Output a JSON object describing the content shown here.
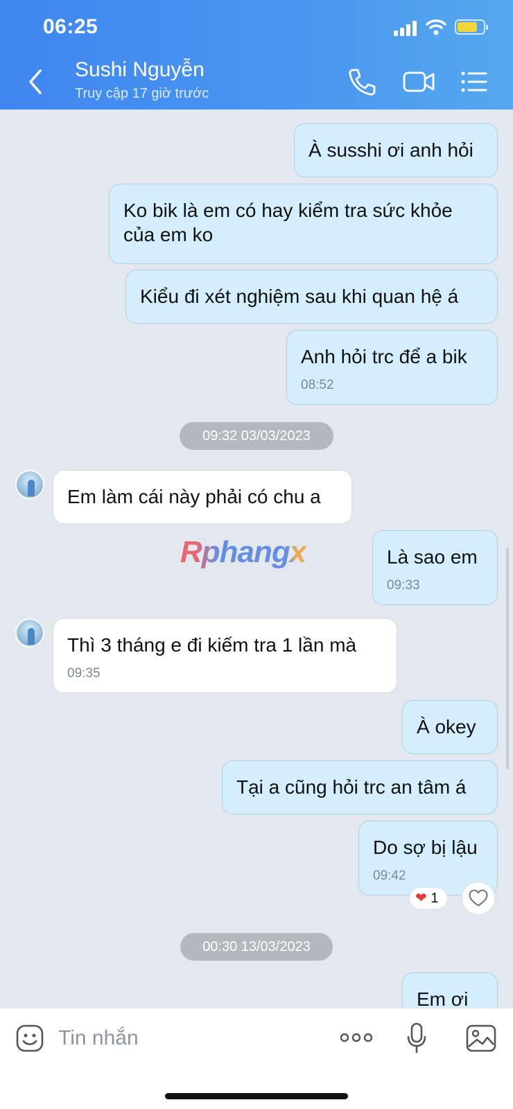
{
  "status_bar": {
    "time": "06:25"
  },
  "header": {
    "contact_name": "Sushi Nguyễn",
    "contact_status": "Truy cập 17 giờ trước"
  },
  "messages": [
    {
      "sender": "me",
      "text": "À susshi ơi anh hỏi"
    },
    {
      "sender": "me",
      "text": "Ko bik là em có hay kiểm tra sức khỏe của em ko"
    },
    {
      "sender": "me",
      "text": "Kiểu đi xét nghiệm sau khi quan hệ á"
    },
    {
      "sender": "me",
      "text": "Anh hỏi trc để a bik",
      "time": "08:52"
    },
    {
      "sender": "them",
      "text": "Em làm cái này phải có chu a"
    },
    {
      "sender": "me",
      "text": "Là sao em",
      "time": "09:33"
    },
    {
      "sender": "them",
      "text": "Thì 3 tháng e đi kiếm tra 1 lần mà",
      "time": "09:35"
    },
    {
      "sender": "me",
      "text": "À okey"
    },
    {
      "sender": "me",
      "text": "Tại a cũng hỏi trc an tâm á"
    },
    {
      "sender": "me",
      "text": "Do sợ bị lậu",
      "time": "09:42",
      "reaction": {
        "emoji": "❤️",
        "count": "1"
      }
    },
    {
      "sender": "me",
      "text": "Em ơi"
    }
  ],
  "date_separators": [
    "09:32 03/03/2023",
    "00:30 13/03/2023"
  ],
  "watermark": "Rphangx",
  "reaction_heart": "❤",
  "input": {
    "placeholder": "Tin nhắn"
  },
  "icons": {
    "back": "chevron-left-icon",
    "call": "phone-icon",
    "video": "video-camera-icon",
    "menu": "list-menu-icon",
    "sticker": "sticker-face-icon",
    "more": "more-dots-icon",
    "mic": "microphone-icon",
    "image": "image-icon",
    "like": "heart-outline-icon"
  },
  "colors": {
    "header_start": "#3f86f0",
    "header_end": "#55a8ee",
    "bubble_me": "#d5eefd",
    "bubble_them": "#ffffff",
    "chat_bg": "#e3e8ef",
    "battery": "#f5d53a"
  }
}
